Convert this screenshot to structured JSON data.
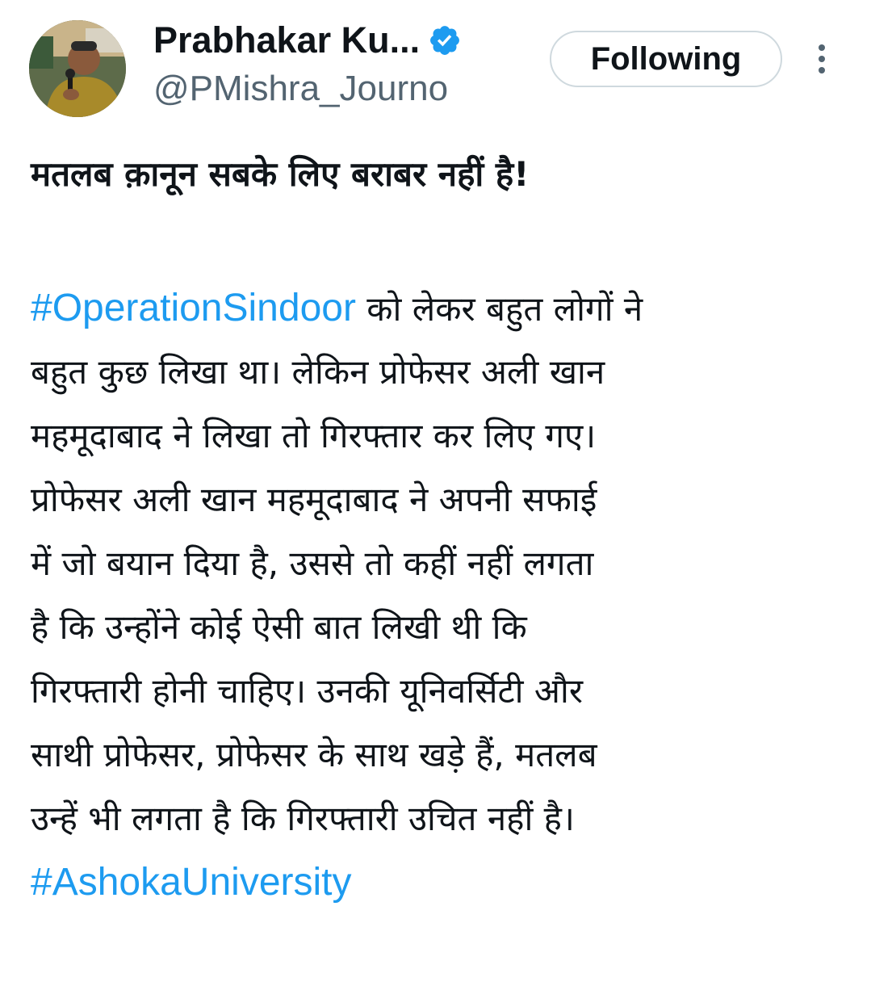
{
  "user": {
    "display_name": "Prabhakar Ku...",
    "handle": "@PMishra_Journo",
    "verified_icon": "verified-badge-icon",
    "verified_color": "#1d9bf0"
  },
  "follow_button": {
    "label": "Following"
  },
  "more_menu": {
    "icon": "more-vertical-icon"
  },
  "tweet": {
    "headline": "मतलब क़ानून सबके लिए बराबर नहीं है!",
    "hashtag_1": "#OperationSindoor",
    "line_1_rest": " को लेकर बहुत लोगों ने",
    "lines": [
      "बहुत कुछ लिखा था। लेकिन प्रोफेसर अली खान",
      "महमूदाबाद ने लिखा तो गिरफ्तार कर लिए गए।",
      "प्रोफेसर अली खान महमूदाबाद ने अपनी सफाई",
      "में जो बयान दिया है, उससे तो कहीं नहीं लगता",
      "है कि उन्होंने कोई ऐसी बात लिखी थी कि",
      "गिरफ्तारी होनी चाहिए। उनकी यूनिवर्सिटी और",
      "साथी प्रोफेसर,  प्रोफेसर के साथ खड़े हैं, मतलब",
      "उन्हें भी लगता है कि गिरफ्तारी उचित नहीं है।"
    ],
    "hashtag_2": "#AshokaUniversity",
    "link_color": "#1d9bf0"
  }
}
